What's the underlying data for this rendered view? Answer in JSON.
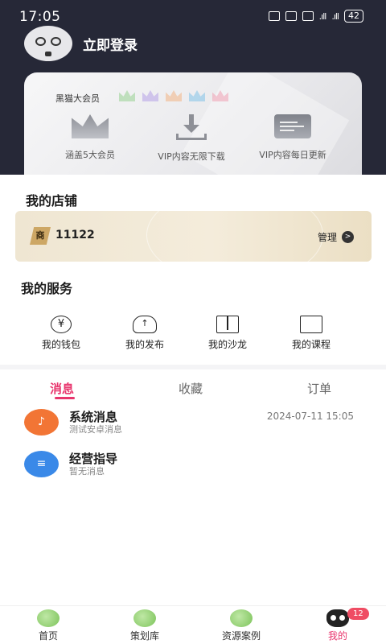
{
  "status_bar": {
    "time": "17:05",
    "signal_1": ".ıll",
    "signal_2": ".ıll",
    "battery": "42"
  },
  "profile": {
    "login_text": "立即登录"
  },
  "vip": {
    "title": "黑猫大会员",
    "crown_colors": [
      "#9fd39a",
      "#b9a7e8",
      "#f2b98d",
      "#8ac7e8",
      "#f0a6b8"
    ],
    "features": [
      {
        "icon": "crown-icon",
        "label": "涵盖5大会员"
      },
      {
        "icon": "download-icon",
        "label": "VIP内容无限下载"
      },
      {
        "icon": "document-icon",
        "label": "VIP内容每日更新"
      }
    ]
  },
  "shop": {
    "heading": "我的店铺",
    "badge": "商",
    "number": "11122",
    "manage_label": "管理",
    "manage_arrow": ">"
  },
  "services": {
    "heading": "我的服务",
    "items": [
      {
        "icon": "wallet-icon",
        "glyph": "¥",
        "label": "我的钱包"
      },
      {
        "icon": "upload-cloud-icon",
        "glyph": "↑",
        "label": "我的发布"
      },
      {
        "icon": "book-icon",
        "glyph": "",
        "label": "我的沙龙"
      },
      {
        "icon": "video-icon",
        "glyph": "",
        "label": "我的课程"
      }
    ]
  },
  "tabs": [
    {
      "label": "消息",
      "active": true
    },
    {
      "label": "收藏",
      "active": false
    },
    {
      "label": "订单",
      "active": false
    }
  ],
  "messages": [
    {
      "icon": "bell-icon",
      "color": "#f27535",
      "title": "系统消息",
      "subtitle": "测试安卓消息",
      "time": "2024-07-11 15:05"
    },
    {
      "icon": "notes-icon",
      "color": "#3a89e8",
      "title": "经营指导",
      "subtitle": "暂无消息",
      "time": ""
    }
  ],
  "bottom_nav": [
    {
      "icon": "home-icon",
      "label": "首页",
      "active": false
    },
    {
      "icon": "search-icon",
      "label": "策划库",
      "active": false
    },
    {
      "icon": "resource-icon",
      "label": "资源案例",
      "active": false
    },
    {
      "icon": "cat-icon",
      "label": "我的",
      "active": true,
      "badge": "12"
    }
  ],
  "colors": {
    "accent": "#e8356d",
    "header_bg": "#262837",
    "gold": "#cda765"
  }
}
